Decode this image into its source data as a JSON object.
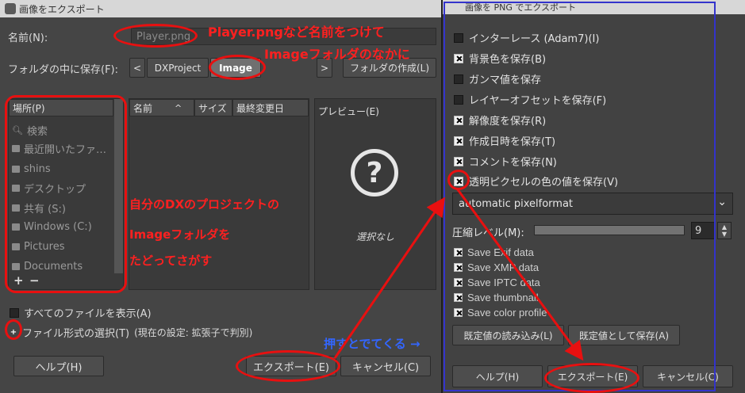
{
  "left_dialog": {
    "title": "画像をエクスポート",
    "name_label": "名前(N):",
    "name_value": "Player.png",
    "folder_label": "フォルダの中に保存(F):",
    "nav_back": "<",
    "nav_forward": ">",
    "breadcrumb": [
      "DXProject",
      "Image"
    ],
    "create_folder": "フォルダの作成(L)",
    "places_header": "場所(P)",
    "places": [
      "検索",
      "最近開いたファ…",
      "shins",
      "デスクトップ",
      "共有 (S:)",
      "Windows (C:)",
      "Pictures",
      "Documents"
    ],
    "add_icon": "+",
    "remove_icon": "−",
    "columns": [
      "名前",
      "サイズ",
      "最終変更日"
    ],
    "preview_header": "プレビュー(E)",
    "preview_empty": "選択なし",
    "show_all_files": "すべてのファイルを表示(A)",
    "file_type": "ファイル形式の選択(T)",
    "file_type_current": "(現在の設定: 拡張子で判別)",
    "help": "ヘルプ(H)",
    "export": "エクスポート(E)",
    "cancel": "キャンセル(C)"
  },
  "right_dialog": {
    "title": "画像を PNG でエクスポート",
    "options": [
      {
        "label": "インターレース (Adam7)(I)",
        "checked": false
      },
      {
        "label": "背景色を保存(B)",
        "checked": true
      },
      {
        "label": "ガンマ値を保存",
        "checked": false
      },
      {
        "label": "レイヤーオフセットを保存(F)",
        "checked": false
      },
      {
        "label": "解像度を保存(R)",
        "checked": true
      },
      {
        "label": "作成日時を保存(T)",
        "checked": true
      },
      {
        "label": "コメントを保存(N)",
        "checked": true
      },
      {
        "label": "透明ピクセルの色の値を保存(V)",
        "checked": true
      }
    ],
    "pixelformat": "automatic pixelformat",
    "compression_label": "圧縮レベル(M):",
    "compression_value": "9",
    "compression_level_fraction": 1.0,
    "meta_options": [
      {
        "label": "Save Exif data",
        "checked": true
      },
      {
        "label": "Save XMP data",
        "checked": true
      },
      {
        "label": "Save IPTC data",
        "checked": true
      },
      {
        "label": "Save thumbnail",
        "checked": true
      },
      {
        "label": "Save color profile",
        "checked": true
      }
    ],
    "load_defaults": "既定値の読み込み(L)",
    "save_defaults": "既定値として保存(A)",
    "help": "ヘルプ(H)",
    "export": "エクスポート(E)",
    "cancel": "キャンセル(C)"
  },
  "annotations": {
    "name_note_1": "Player.pngなど名前をつけて",
    "name_note_2": "Imageフォルダのなかに",
    "folder_note_1": "自分のDXのプロジェクトの",
    "folder_note_2": "Imageフォルダを",
    "folder_note_3": "たどってさがす",
    "press_note": "押すとでてくる"
  },
  "colors": {
    "annotation_red": "#ff2020",
    "annotation_blue": "#3366ff",
    "dialog_border_blue": "#3333cc"
  }
}
